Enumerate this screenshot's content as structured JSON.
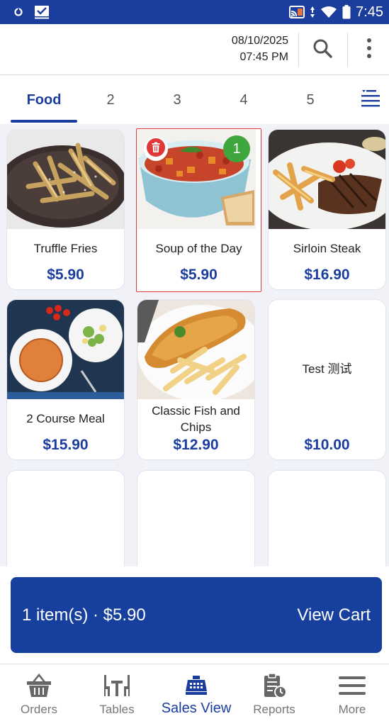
{
  "status_bar": {
    "time": "7:45",
    "icons": [
      "data-saver-icon",
      "check-box-icon",
      "cast-icon",
      "data-arrows-icon",
      "wifi-icon",
      "battery-icon"
    ]
  },
  "header": {
    "date": "08/10/2025",
    "time": "07:45 PM",
    "icons": [
      "search-icon",
      "more-vertical-icon"
    ]
  },
  "tabs": [
    {
      "label": "Food",
      "active": true
    },
    {
      "label": "2",
      "active": false
    },
    {
      "label": "3",
      "active": false
    },
    {
      "label": "4",
      "active": false
    },
    {
      "label": "5",
      "active": false
    }
  ],
  "tab_menu_icon": "list-filter-icon",
  "products": [
    {
      "name": "Truffle Fries",
      "price": "$5.90",
      "image": "truffle-fries"
    },
    {
      "name": "Soup of the Day",
      "price": "$5.90",
      "image": "tomato-soup",
      "selected": true,
      "quantity": "1"
    },
    {
      "name": "Sirloin Steak",
      "price": "$16.90",
      "image": "sirloin-steak"
    },
    {
      "name": "2 Course Meal",
      "price": "$15.90",
      "image": "course-meal"
    },
    {
      "name": "Classic Fish and Chips",
      "price": "$12.90",
      "image": "fish-and-chips"
    },
    {
      "name": "Test 测试",
      "price": "$10.00",
      "image": null
    },
    {
      "name": "",
      "price": "",
      "image": null
    },
    {
      "name": "",
      "price": "",
      "image": null
    },
    {
      "name": "",
      "price": "",
      "image": null
    }
  ],
  "cart": {
    "summary": "1 item(s) · $5.90",
    "action": "View Cart"
  },
  "bottom_nav": [
    {
      "label": "Orders",
      "icon": "basket-icon",
      "active": false
    },
    {
      "label": "Tables",
      "icon": "table-chairs-icon",
      "active": false
    },
    {
      "label": "Sales View",
      "icon": "cash-register-icon",
      "active": true
    },
    {
      "label": "Reports",
      "icon": "clipboard-report-icon",
      "active": false
    },
    {
      "label": "More",
      "icon": "hamburger-menu-icon",
      "active": false
    }
  ],
  "colors": {
    "primary": "#1a3d9e",
    "badge_green": "#3ea63c",
    "delete_red": "#e03838",
    "grid_background": "#f1f2f8"
  }
}
